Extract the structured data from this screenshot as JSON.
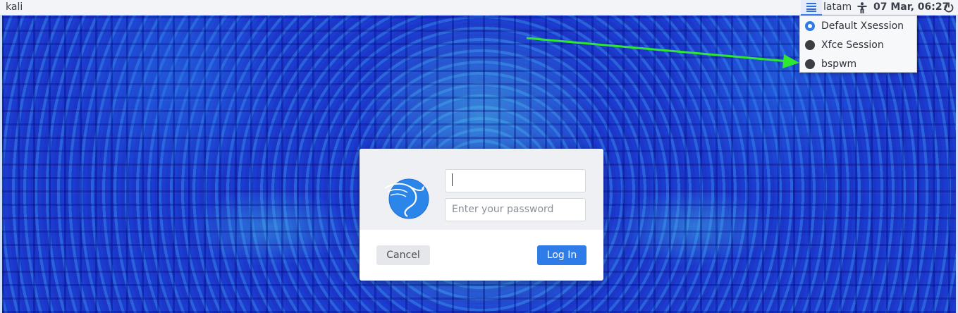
{
  "top_panel": {
    "hostname": "kali",
    "session_icon": "session-list-icon",
    "keyboard_layout": "latam",
    "accessibility_icon": "accessibility-icon",
    "clock": "07 Mar, 06:27",
    "power_icon": "power-icon"
  },
  "session_menu": {
    "items": [
      {
        "label": "Default Xsession",
        "selected": true
      },
      {
        "label": "Xfce Session",
        "selected": false
      },
      {
        "label": "bspwm",
        "selected": false
      }
    ]
  },
  "login": {
    "logo_icon": "kali-dragon-icon",
    "username_value": "",
    "password_placeholder": "Enter your password",
    "cancel_label": "Cancel",
    "login_label": "Log In"
  },
  "colors": {
    "accent": "#2f7ce8",
    "annotation_arrow": "#2ee82e"
  }
}
